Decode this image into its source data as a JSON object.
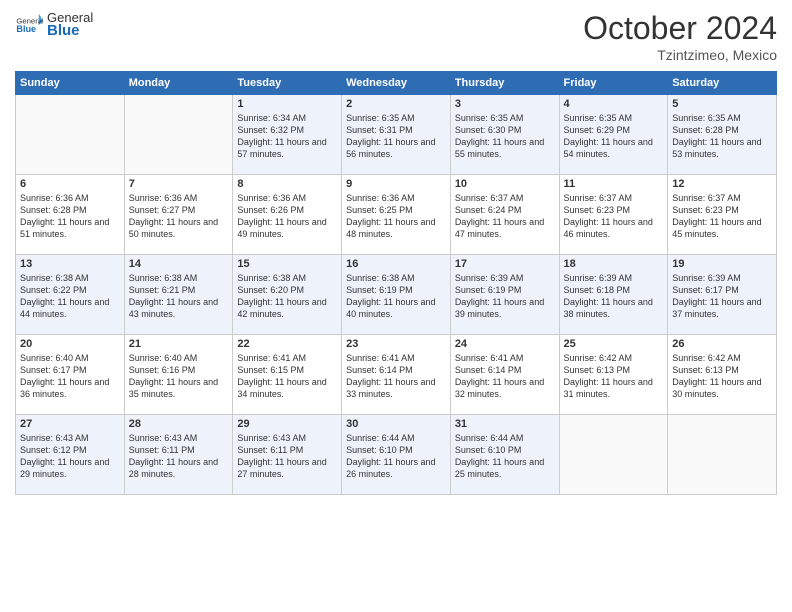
{
  "header": {
    "logo_general": "General",
    "logo_blue": "Blue",
    "month": "October 2024",
    "location": "Tzintzimeo, Mexico"
  },
  "days_of_week": [
    "Sunday",
    "Monday",
    "Tuesday",
    "Wednesday",
    "Thursday",
    "Friday",
    "Saturday"
  ],
  "weeks": [
    [
      {
        "day": "",
        "info": ""
      },
      {
        "day": "",
        "info": ""
      },
      {
        "day": "1",
        "info": "Sunrise: 6:34 AM\nSunset: 6:32 PM\nDaylight: 11 hours and 57 minutes."
      },
      {
        "day": "2",
        "info": "Sunrise: 6:35 AM\nSunset: 6:31 PM\nDaylight: 11 hours and 56 minutes."
      },
      {
        "day": "3",
        "info": "Sunrise: 6:35 AM\nSunset: 6:30 PM\nDaylight: 11 hours and 55 minutes."
      },
      {
        "day": "4",
        "info": "Sunrise: 6:35 AM\nSunset: 6:29 PM\nDaylight: 11 hours and 54 minutes."
      },
      {
        "day": "5",
        "info": "Sunrise: 6:35 AM\nSunset: 6:28 PM\nDaylight: 11 hours and 53 minutes."
      }
    ],
    [
      {
        "day": "6",
        "info": "Sunrise: 6:36 AM\nSunset: 6:28 PM\nDaylight: 11 hours and 51 minutes."
      },
      {
        "day": "7",
        "info": "Sunrise: 6:36 AM\nSunset: 6:27 PM\nDaylight: 11 hours and 50 minutes."
      },
      {
        "day": "8",
        "info": "Sunrise: 6:36 AM\nSunset: 6:26 PM\nDaylight: 11 hours and 49 minutes."
      },
      {
        "day": "9",
        "info": "Sunrise: 6:36 AM\nSunset: 6:25 PM\nDaylight: 11 hours and 48 minutes."
      },
      {
        "day": "10",
        "info": "Sunrise: 6:37 AM\nSunset: 6:24 PM\nDaylight: 11 hours and 47 minutes."
      },
      {
        "day": "11",
        "info": "Sunrise: 6:37 AM\nSunset: 6:23 PM\nDaylight: 11 hours and 46 minutes."
      },
      {
        "day": "12",
        "info": "Sunrise: 6:37 AM\nSunset: 6:23 PM\nDaylight: 11 hours and 45 minutes."
      }
    ],
    [
      {
        "day": "13",
        "info": "Sunrise: 6:38 AM\nSunset: 6:22 PM\nDaylight: 11 hours and 44 minutes."
      },
      {
        "day": "14",
        "info": "Sunrise: 6:38 AM\nSunset: 6:21 PM\nDaylight: 11 hours and 43 minutes."
      },
      {
        "day": "15",
        "info": "Sunrise: 6:38 AM\nSunset: 6:20 PM\nDaylight: 11 hours and 42 minutes."
      },
      {
        "day": "16",
        "info": "Sunrise: 6:38 AM\nSunset: 6:19 PM\nDaylight: 11 hours and 40 minutes."
      },
      {
        "day": "17",
        "info": "Sunrise: 6:39 AM\nSunset: 6:19 PM\nDaylight: 11 hours and 39 minutes."
      },
      {
        "day": "18",
        "info": "Sunrise: 6:39 AM\nSunset: 6:18 PM\nDaylight: 11 hours and 38 minutes."
      },
      {
        "day": "19",
        "info": "Sunrise: 6:39 AM\nSunset: 6:17 PM\nDaylight: 11 hours and 37 minutes."
      }
    ],
    [
      {
        "day": "20",
        "info": "Sunrise: 6:40 AM\nSunset: 6:17 PM\nDaylight: 11 hours and 36 minutes."
      },
      {
        "day": "21",
        "info": "Sunrise: 6:40 AM\nSunset: 6:16 PM\nDaylight: 11 hours and 35 minutes."
      },
      {
        "day": "22",
        "info": "Sunrise: 6:41 AM\nSunset: 6:15 PM\nDaylight: 11 hours and 34 minutes."
      },
      {
        "day": "23",
        "info": "Sunrise: 6:41 AM\nSunset: 6:14 PM\nDaylight: 11 hours and 33 minutes."
      },
      {
        "day": "24",
        "info": "Sunrise: 6:41 AM\nSunset: 6:14 PM\nDaylight: 11 hours and 32 minutes."
      },
      {
        "day": "25",
        "info": "Sunrise: 6:42 AM\nSunset: 6:13 PM\nDaylight: 11 hours and 31 minutes."
      },
      {
        "day": "26",
        "info": "Sunrise: 6:42 AM\nSunset: 6:13 PM\nDaylight: 11 hours and 30 minutes."
      }
    ],
    [
      {
        "day": "27",
        "info": "Sunrise: 6:43 AM\nSunset: 6:12 PM\nDaylight: 11 hours and 29 minutes."
      },
      {
        "day": "28",
        "info": "Sunrise: 6:43 AM\nSunset: 6:11 PM\nDaylight: 11 hours and 28 minutes."
      },
      {
        "day": "29",
        "info": "Sunrise: 6:43 AM\nSunset: 6:11 PM\nDaylight: 11 hours and 27 minutes."
      },
      {
        "day": "30",
        "info": "Sunrise: 6:44 AM\nSunset: 6:10 PM\nDaylight: 11 hours and 26 minutes."
      },
      {
        "day": "31",
        "info": "Sunrise: 6:44 AM\nSunset: 6:10 PM\nDaylight: 11 hours and 25 minutes."
      },
      {
        "day": "",
        "info": ""
      },
      {
        "day": "",
        "info": ""
      }
    ]
  ]
}
